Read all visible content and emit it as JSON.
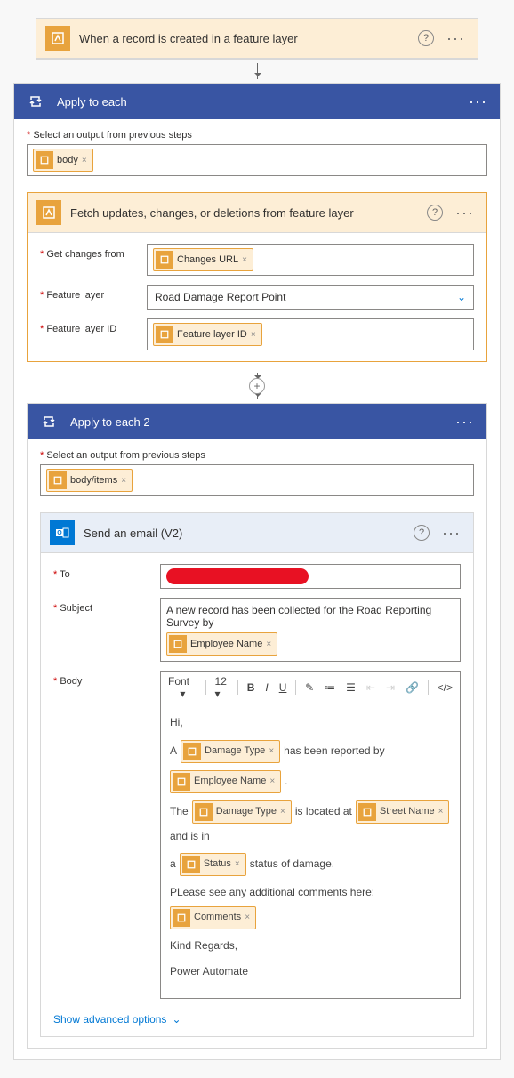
{
  "trigger": {
    "title": "When a record is created in a feature layer"
  },
  "applyEach1": {
    "title": "Apply to each",
    "selectLabel": "Select an output from previous steps",
    "token": "body"
  },
  "fetch": {
    "title": "Fetch updates, changes, or deletions from feature layer",
    "rows": {
      "getChanges": {
        "label": "Get changes from",
        "token": "Changes URL"
      },
      "featureLayer": {
        "label": "Feature layer",
        "value": "Road Damage Report Point"
      },
      "featureLayerId": {
        "label": "Feature layer ID",
        "token": "Feature layer ID"
      }
    }
  },
  "applyEach2": {
    "title": "Apply to each 2",
    "selectLabel": "Select an output from previous steps",
    "token": "body/items"
  },
  "email": {
    "title": "Send an email (V2)",
    "toLabel": "To",
    "subjectLabel": "Subject",
    "bodyLabel": "Body",
    "subjectText": "A new record has been collected for the Road Reporting Survey by",
    "subjectToken": "Employee Name",
    "toolbar": {
      "font": "Font",
      "size": "12"
    },
    "body": {
      "hi": "Hi,",
      "line1a": "A",
      "tokDamage": "Damage Type",
      "line1b": "has been reported by",
      "tokEmployee": "Employee Name",
      "line2a": "The",
      "line2b": "is located at",
      "tokStreet": "Street Name",
      "line2c": "and is in",
      "line3a": "a",
      "tokStatus": "Status",
      "line3b": "status of damage.",
      "line4": "PLease see any additional comments here:",
      "tokComments": "Comments",
      "regards": "Kind Regards,",
      "sig": "Power Automate"
    },
    "advanced": "Show advanced options"
  }
}
